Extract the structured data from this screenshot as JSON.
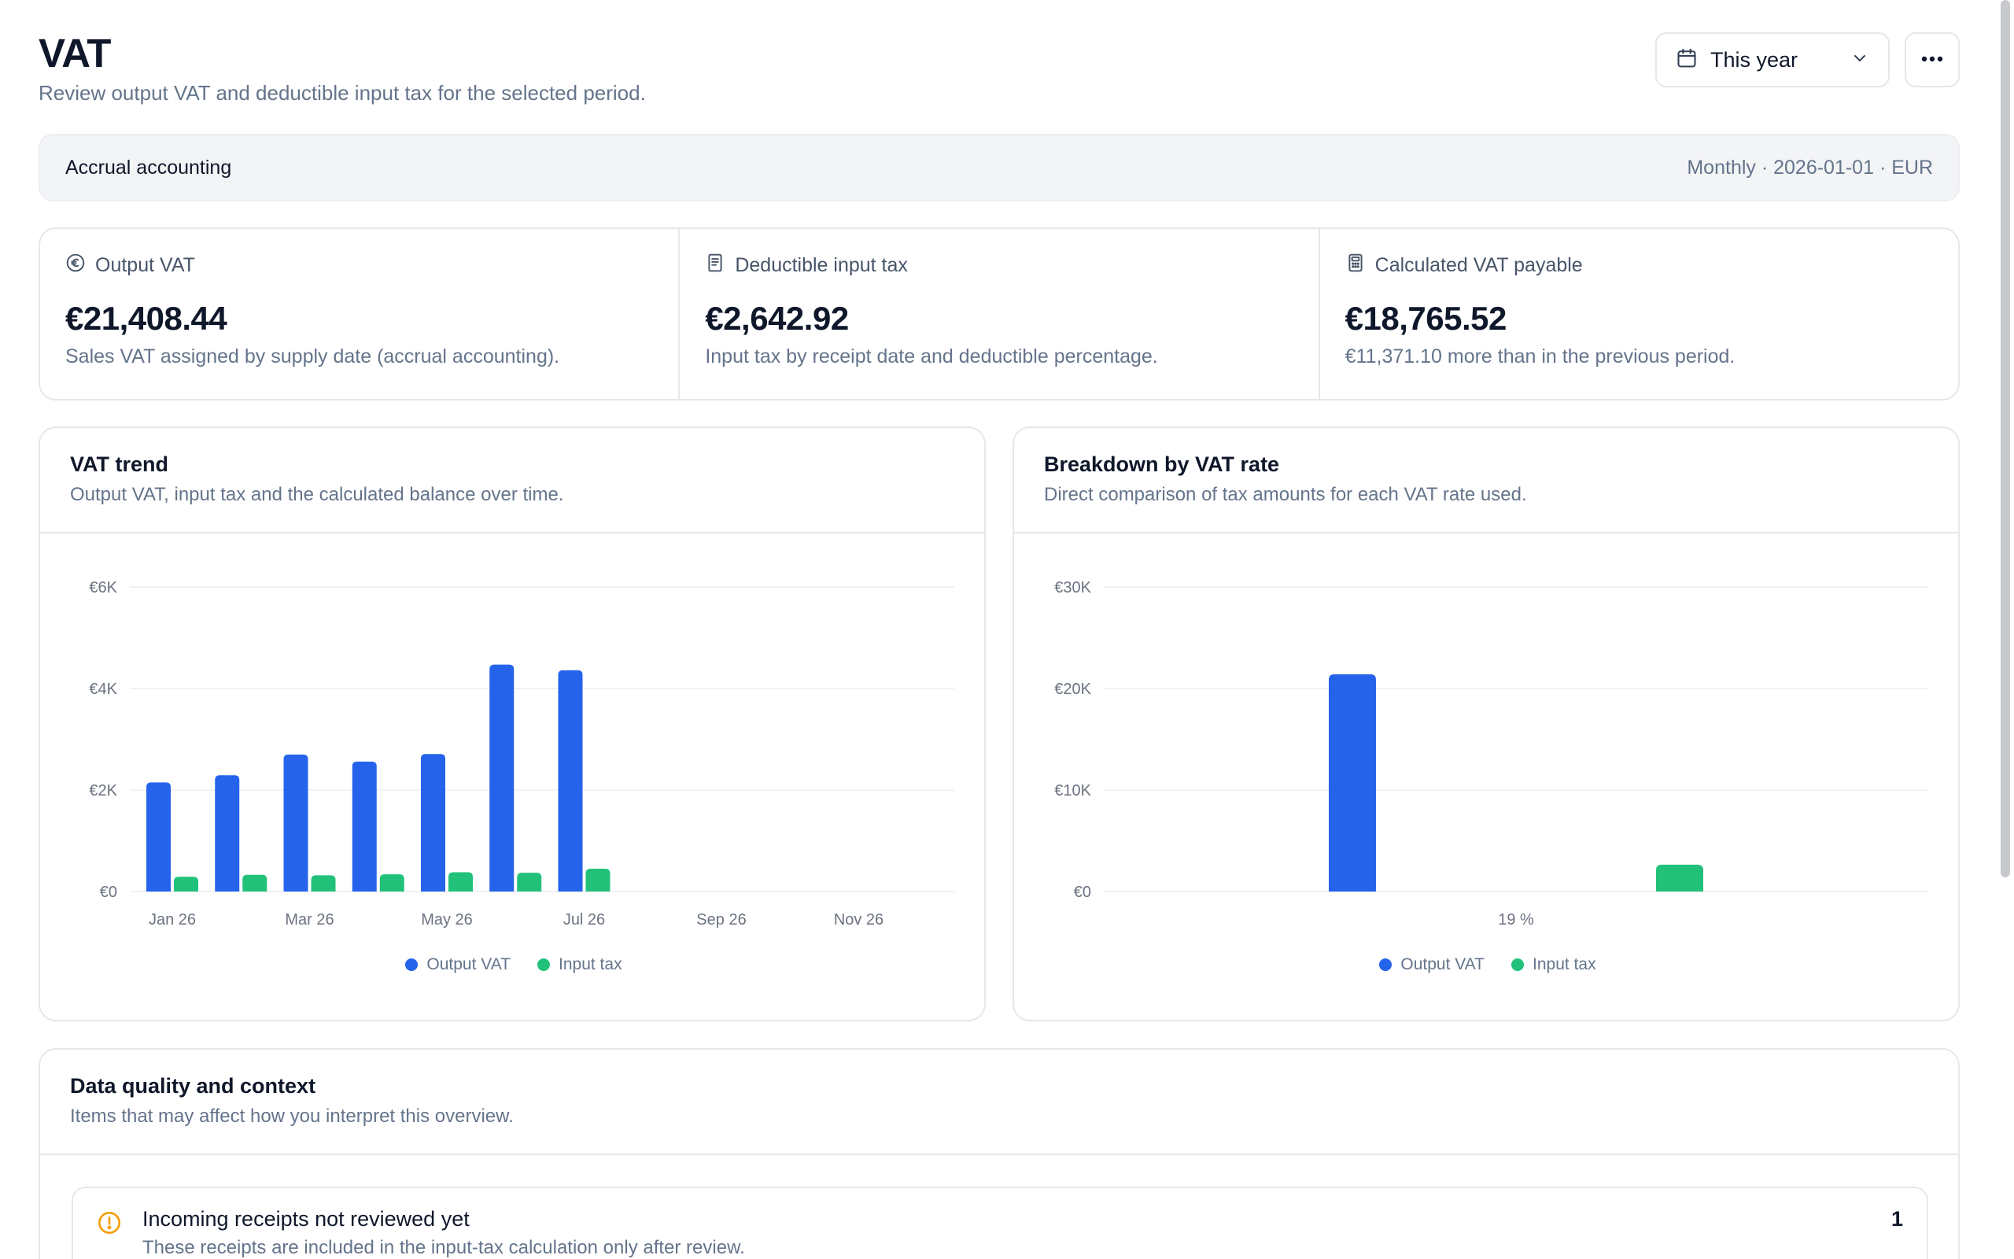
{
  "header": {
    "title": "VAT",
    "subtitle": "Review output VAT and deductible input tax for the selected period.",
    "period_label": "This year"
  },
  "info_bar": {
    "method": "Accrual accounting",
    "meta": "Monthly · 2026-01-01 · EUR"
  },
  "kpis": [
    {
      "icon": "euro-circle-icon",
      "label": "Output VAT",
      "value": "€21,408.44",
      "description": "Sales VAT assigned by supply date (accrual accounting)."
    },
    {
      "icon": "receipt-icon",
      "label": "Deductible input tax",
      "value": "€2,642.92",
      "description": "Input tax by receipt date and deductible percentage."
    },
    {
      "icon": "calculator-icon",
      "label": "Calculated VAT payable",
      "value": "€18,765.52",
      "description": "€11,371.10 more than in the previous period."
    }
  ],
  "trend_card": {
    "title": "VAT trend",
    "subtitle": "Output VAT, input tax and the calculated balance over time."
  },
  "rate_card": {
    "title": "Breakdown by VAT rate",
    "subtitle": "Direct comparison of tax amounts for each VAT rate used."
  },
  "colors": {
    "output_vat": "#2563eb",
    "input_tax": "#22c17a",
    "grid": "#eceef1",
    "tick": "#6b7280"
  },
  "chart_data": [
    {
      "type": "bar",
      "title": "VAT trend",
      "categories": [
        "Jan 26",
        "Feb 26",
        "Mar 26",
        "Apr 26",
        "May 26",
        "Jun 26",
        "Jul 26",
        "Aug 26",
        "Sep 26",
        "Oct 26",
        "Nov 26",
        "Dec 26"
      ],
      "tick_labels": [
        "Jan 26",
        "Mar 26",
        "May 26",
        "Jul 26",
        "Sep 26",
        "Nov 26"
      ],
      "series": [
        {
          "name": "Output VAT",
          "values": [
            2150,
            2290,
            2700,
            2560,
            2710,
            4470,
            4360,
            null,
            null,
            null,
            null,
            null
          ]
        },
        {
          "name": "Input tax",
          "values": [
            290,
            330,
            320,
            340,
            380,
            370,
            450,
            null,
            null,
            null,
            null,
            null
          ]
        }
      ],
      "ylim": [
        0,
        6000
      ],
      "yticks": [
        {
          "value": 0,
          "label": "€0"
        },
        {
          "value": 2000,
          "label": "€2K"
        },
        {
          "value": 4000,
          "label": "€4K"
        },
        {
          "value": 6000,
          "label": "€6K"
        }
      ],
      "grid": true,
      "legend": "bottom-center"
    },
    {
      "type": "bar",
      "title": "Breakdown by VAT rate",
      "categories": [
        "19 %"
      ],
      "series": [
        {
          "name": "Output VAT",
          "values": [
            21408.44
          ]
        },
        {
          "name": "Input tax",
          "values": [
            2642.92
          ]
        }
      ],
      "ylim": [
        0,
        30000
      ],
      "yticks": [
        {
          "value": 0,
          "label": "€0"
        },
        {
          "value": 10000,
          "label": "€10K"
        },
        {
          "value": 20000,
          "label": "€20K"
        },
        {
          "value": 30000,
          "label": "€30K"
        }
      ],
      "grid": true,
      "legend": "bottom-center"
    }
  ],
  "data_quality": {
    "title": "Data quality and context",
    "subtitle": "Items that may affect how you interpret this overview.",
    "items": [
      {
        "title": "Incoming receipts not reviewed yet",
        "description": "These receipts are included in the input-tax calculation only after review.",
        "count": "1"
      }
    ]
  }
}
